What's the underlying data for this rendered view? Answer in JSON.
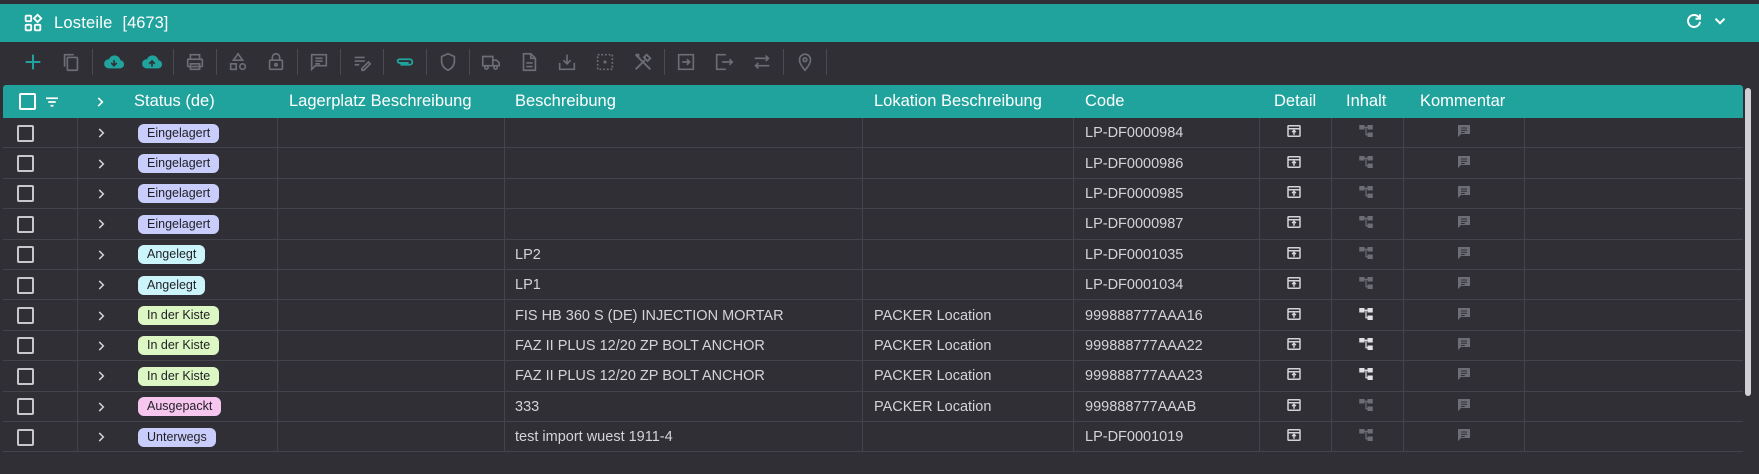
{
  "window": {
    "title": "Losteile",
    "count": "[4673]"
  },
  "toolbar": {
    "icons": [
      "add-icon",
      "copy-icon",
      "cloud-download-icon",
      "cloud-upload-icon",
      "print-icon",
      "shapes-icon",
      "lock-icon",
      "comment-icon",
      "edit-list-icon",
      "attachment-icon",
      "shield-icon",
      "truck-icon",
      "document-icon",
      "download-box-icon",
      "frame-icon",
      "tools-icon",
      "login-icon",
      "logout-icon",
      "swap-icon",
      "location-pin-icon"
    ]
  },
  "columns": {
    "status": "Status (de)",
    "lagerplatz": "Lagerplatz Beschreibung",
    "beschreibung": "Beschreibung",
    "lokation": "Lokation Beschreibung",
    "code": "Code",
    "detail": "Detail",
    "inhalt": "Inhalt",
    "kommentar": "Kommentar"
  },
  "rows": [
    {
      "status": "Eingelagert",
      "status_kind": "eing",
      "lagerplatz": "",
      "beschreibung": "",
      "lokation": "",
      "code": "LP-DF0000984",
      "inhalt_active": false
    },
    {
      "status": "Eingelagert",
      "status_kind": "eing",
      "lagerplatz": "",
      "beschreibung": "",
      "lokation": "",
      "code": "LP-DF0000986",
      "inhalt_active": false
    },
    {
      "status": "Eingelagert",
      "status_kind": "eing",
      "lagerplatz": "",
      "beschreibung": "",
      "lokation": "",
      "code": "LP-DF0000985",
      "inhalt_active": false
    },
    {
      "status": "Eingelagert",
      "status_kind": "eing",
      "lagerplatz": "",
      "beschreibung": "",
      "lokation": "",
      "code": "LP-DF0000987",
      "inhalt_active": false
    },
    {
      "status": "Angelegt",
      "status_kind": "ange",
      "lagerplatz": "",
      "beschreibung": "LP2",
      "lokation": "",
      "code": "LP-DF0001035",
      "inhalt_active": false
    },
    {
      "status": "Angelegt",
      "status_kind": "ange",
      "lagerplatz": "",
      "beschreibung": "LP1",
      "lokation": "",
      "code": "LP-DF0001034",
      "inhalt_active": false
    },
    {
      "status": "In der Kiste",
      "status_kind": "kiste",
      "lagerplatz": "",
      "beschreibung": "FIS HB 360 S (DE) INJECTION MORTAR",
      "lokation": "PACKER Location",
      "code": "999888777AAA16",
      "inhalt_active": true
    },
    {
      "status": "In der Kiste",
      "status_kind": "kiste",
      "lagerplatz": "",
      "beschreibung": "FAZ II PLUS 12/20 ZP BOLT ANCHOR",
      "lokation": "PACKER Location",
      "code": "999888777AAA22",
      "inhalt_active": true
    },
    {
      "status": "In der Kiste",
      "status_kind": "kiste",
      "lagerplatz": "",
      "beschreibung": "FAZ II PLUS 12/20 ZP BOLT ANCHOR",
      "lokation": "PACKER Location",
      "code": "999888777AAA23",
      "inhalt_active": true
    },
    {
      "status": "Ausgepackt",
      "status_kind": "ausg",
      "lagerplatz": "",
      "beschreibung": "333",
      "lokation": "PACKER Location",
      "code": "999888777AAAB",
      "inhalt_active": false
    },
    {
      "status": "Unterwegs",
      "status_kind": "unter",
      "lagerplatz": "",
      "beschreibung": "test import wuest 1911-4",
      "lokation": "",
      "code": "LP-DF0001019",
      "inhalt_active": false
    }
  ],
  "colors": {
    "accent": "#20a39c",
    "background": "#2f2f35",
    "row_border": "#43434b"
  }
}
